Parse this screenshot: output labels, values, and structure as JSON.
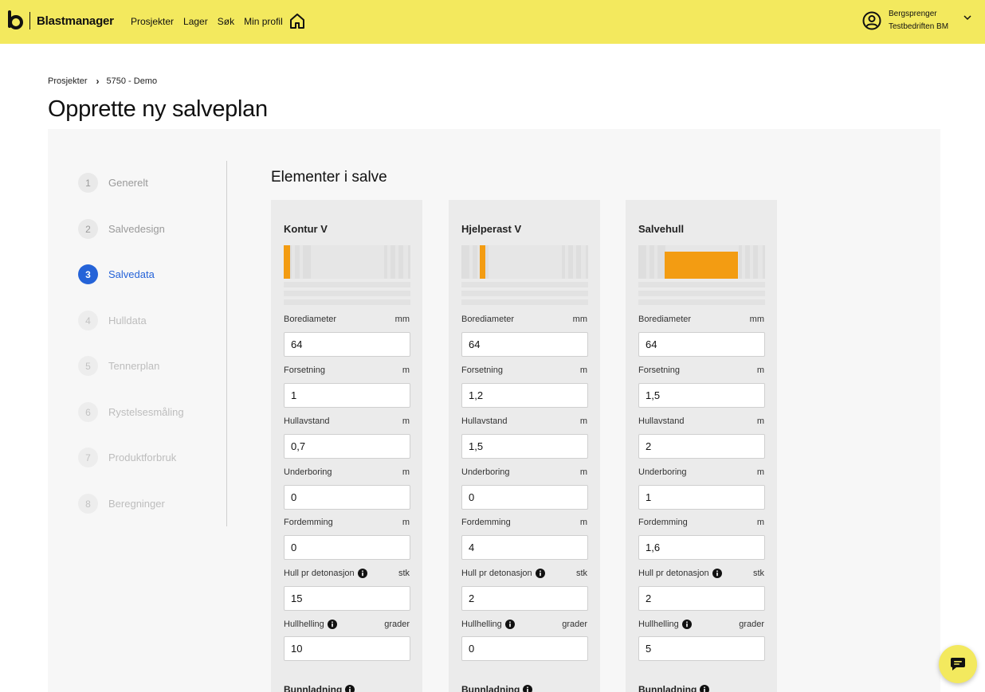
{
  "app": {
    "name": "Blastmanager"
  },
  "nav": {
    "items": [
      "Prosjekter",
      "Lager",
      "Søk",
      "Min profil"
    ]
  },
  "user": {
    "name": "Bergsprenger",
    "company": "Testbedriften BM"
  },
  "breadcrumb": {
    "root": "Prosjekter",
    "current": "5750 - Demo"
  },
  "page": {
    "title": "Opprette ny salveplan"
  },
  "steps": [
    {
      "num": "1",
      "label": "Generelt",
      "state": "done"
    },
    {
      "num": "2",
      "label": "Salvedesign",
      "state": "done"
    },
    {
      "num": "3",
      "label": "Salvedata",
      "state": "active"
    },
    {
      "num": "4",
      "label": "Hulldata",
      "state": "todo"
    },
    {
      "num": "5",
      "label": "Tennerplan",
      "state": "todo"
    },
    {
      "num": "6",
      "label": "Rystelsesmåling",
      "state": "todo"
    },
    {
      "num": "7",
      "label": "Produktforbruk",
      "state": "todo"
    },
    {
      "num": "8",
      "label": "Beregninger",
      "state": "todo"
    }
  ],
  "section": {
    "title": "Elementer i salve"
  },
  "field_labels": {
    "borediameter": "Borediameter",
    "forsetning": "Forsetning",
    "hullavstand": "Hullavstand",
    "underboring": "Underboring",
    "fordemming": "Fordemming",
    "hull_pr_detonasjon": "Hull pr detonasjon",
    "hullhelling": "Hullhelling",
    "bunnladning": "Bunnladning"
  },
  "units": {
    "mm": "mm",
    "m": "m",
    "stk": "stk",
    "grader": "grader"
  },
  "cards": [
    {
      "title": "Kontur V",
      "values": {
        "borediameter": "64",
        "forsetning": "1",
        "hullavstand": "0,7",
        "underboring": "0",
        "fordemming": "0",
        "hull_pr_detonasjon": "15",
        "hullhelling": "10"
      }
    },
    {
      "title": "Hjelperast V",
      "values": {
        "borediameter": "64",
        "forsetning": "1,2",
        "hullavstand": "1,5",
        "underboring": "0",
        "fordemming": "4",
        "hull_pr_detonasjon": "2",
        "hullhelling": "0"
      }
    },
    {
      "title": "Salvehull",
      "values": {
        "borediameter": "64",
        "forsetning": "1,5",
        "hullavstand": "2",
        "underboring": "1",
        "fordemming": "1,6",
        "hull_pr_detonasjon": "2",
        "hullhelling": "5"
      }
    }
  ],
  "colors": {
    "brand_yellow": "#f3e95e",
    "accent_blue": "#2563d8",
    "highlight_orange": "#f39c12"
  },
  "icons": {
    "home": "home-icon",
    "user": "user-circle-icon",
    "chevron": "chevron-down-icon",
    "info": "info-icon",
    "chat": "chat-icon"
  }
}
